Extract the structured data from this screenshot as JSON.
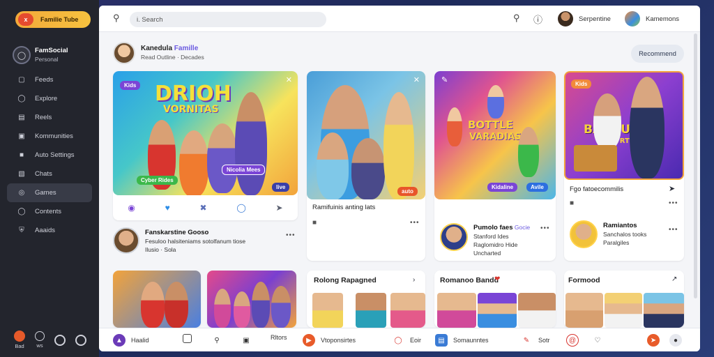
{
  "app": {
    "brand": "Familie Tube",
    "brand_badge": "x"
  },
  "sidebar": {
    "profile_name": "FamSocial",
    "profile_sub": "Personal",
    "items": [
      {
        "label": "Feeds",
        "icon": "feed-icon"
      },
      {
        "label": "Explore",
        "icon": "compass-icon"
      },
      {
        "label": "Reels",
        "icon": "reels-icon"
      },
      {
        "label": "Kommunities",
        "icon": "community-icon"
      },
      {
        "label": "Auto Settings",
        "icon": "settings-icon"
      },
      {
        "label": "Chats",
        "icon": "chat-icon"
      },
      {
        "label": "Games",
        "icon": "games-icon"
      },
      {
        "label": "Contents",
        "icon": "contents-icon"
      },
      {
        "label": "Aaaids",
        "icon": "shield-icon"
      }
    ],
    "active_index": 6,
    "bottom": [
      {
        "label": "Bad",
        "icon": "record-icon"
      },
      {
        "label": "ws",
        "icon": "settings-icon"
      }
    ]
  },
  "topbar": {
    "search_placeholder": "i. Search",
    "user1": "Serpentine",
    "user2": "Kamemons"
  },
  "post": {
    "author": "Kanedula",
    "author_tag": "Famille",
    "meta": "Read Outline · Decades",
    "recommend": "Recommend"
  },
  "cards": {
    "card1": {
      "banner_line1": "DRIOH",
      "banner_line2": "VORNITAS",
      "sticker_top": "Kids",
      "sticker_bottom": "Cyber Rides",
      "sticker_right": "Nicolia Mees",
      "sticker_corner": "live"
    },
    "card2": {
      "caption": "Ramifuinis anting lats",
      "sticker": "auto",
      "more": "•••"
    },
    "card3": {
      "banner_line1": "BOTTLE",
      "banner_line2": "VARADIAS",
      "sticker": "Kidaline",
      "sticker2": "Avile",
      "author": "Pumolo faes",
      "author_tag": "Gocie",
      "line1": "Stanford Ides",
      "line2": "Raglomidro Hide",
      "line3": "Uncharted",
      "more": "•••"
    },
    "card4": {
      "banner_line1": "BARGUIT",
      "banner_line2": "VRTUL",
      "sticker": "Kids",
      "caption": "Fgo fatoecommilis",
      "author": "Ramiantos",
      "line1": "Sanchalos tooks",
      "line2": "Paralgiles",
      "more": "•••"
    }
  },
  "feed_post": {
    "author": "Fanskarstine Gooso",
    "meta": "Fesuloo halsiteniams sotolfanum tiose",
    "meta2": "Ilusio · Sola",
    "more": "•••"
  },
  "sections": {
    "s1": "Rolong Rapagned",
    "s2": "Romanoo Bandd",
    "s3": "Formood"
  },
  "bottombar": [
    {
      "label": "Haalid",
      "icon": "home-icon"
    },
    {
      "label": "",
      "icon": "bookmark-icon"
    },
    {
      "label": "",
      "icon": "search-icon"
    },
    {
      "label": "",
      "icon": "image-icon"
    },
    {
      "label": "Rltors",
      "icon": "filter-icon"
    },
    {
      "label": "Vtoponsirtes",
      "icon": "video-icon"
    },
    {
      "label": "Eoir",
      "icon": "chat-icon"
    },
    {
      "label": "Somaunntes",
      "icon": "community-icon"
    },
    {
      "label": "Sotr",
      "icon": "edit-icon"
    },
    {
      "label": "",
      "icon": "at-icon"
    },
    {
      "label": "",
      "icon": "heart-icon"
    }
  ],
  "colors": {
    "accent_orange": "#e85b2a",
    "accent_purple": "#6b5ae0",
    "sidebar_bg": "#23252d"
  }
}
